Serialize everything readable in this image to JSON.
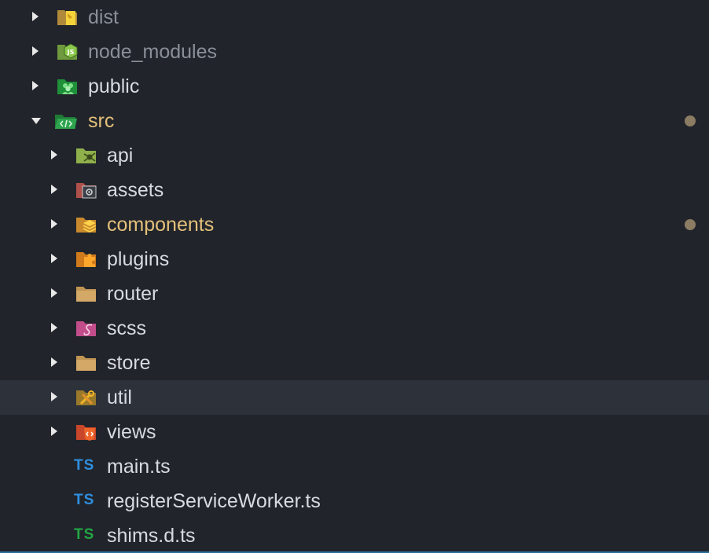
{
  "tree": {
    "dist": {
      "label": "dist",
      "icon": "dist-folder-icon"
    },
    "node_modules": {
      "label": "node_modules",
      "icon": "nodejs-folder-icon"
    },
    "public": {
      "label": "public",
      "icon": "public-folder-icon"
    },
    "src": {
      "label": "src",
      "icon": "src-folder-icon"
    },
    "api": {
      "label": "api",
      "icon": "api-folder-icon"
    },
    "assets": {
      "label": "assets",
      "icon": "assets-folder-icon"
    },
    "components": {
      "label": "components",
      "icon": "components-folder-icon"
    },
    "plugins": {
      "label": "plugins",
      "icon": "plugins-folder-icon"
    },
    "router": {
      "label": "router",
      "icon": "folder-icon"
    },
    "scss": {
      "label": "scss",
      "icon": "sass-folder-icon"
    },
    "store": {
      "label": "store",
      "icon": "folder-icon"
    },
    "util": {
      "label": "util",
      "icon": "tools-folder-icon"
    },
    "views": {
      "label": "views",
      "icon": "html-folder-icon"
    },
    "main_ts": {
      "label": "main.ts",
      "badge": "TS"
    },
    "register_ts": {
      "label": "registerServiceWorker.ts",
      "badge": "TS"
    },
    "shims_ts": {
      "label": "shims.d.ts",
      "badge": "TS"
    }
  },
  "colors": {
    "background": "#21252b",
    "hover_row": "#2c313a",
    "text": "#d7dae0",
    "ignored_text": "#8a8f98",
    "modified_text": "#e5c07b",
    "modified_dot": "#8c7c63",
    "ts_blue": "#2f8fe0",
    "ts_green": "#23a643"
  }
}
